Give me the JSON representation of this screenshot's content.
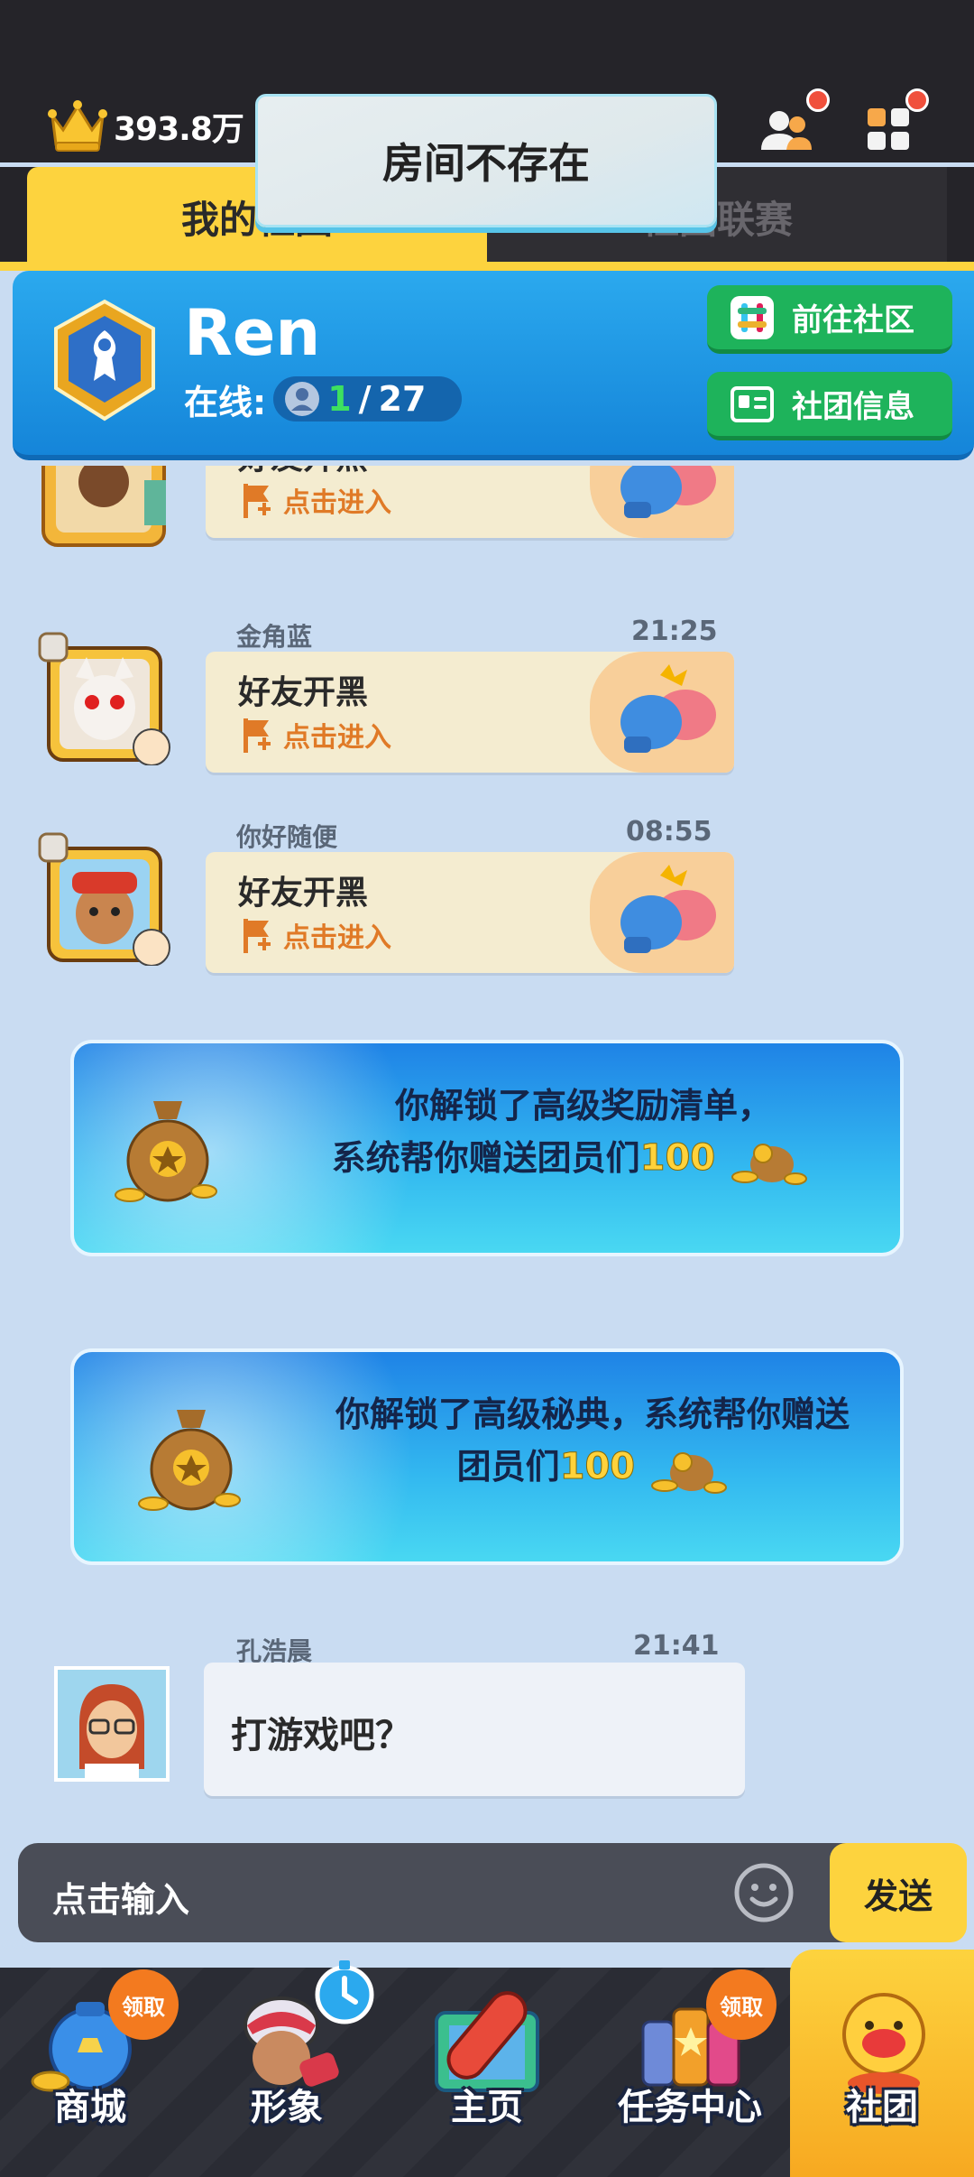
{
  "top_bar": {
    "currency_value": "393.8万",
    "currency_icon": "crown-icon",
    "friends_icon": "friends-icon",
    "apps_icon": "apps-icon"
  },
  "toast": {
    "message": "房间不存在"
  },
  "tabs": [
    {
      "label": "我的社团",
      "active": true
    },
    {
      "label": "社团联赛",
      "active": false
    }
  ],
  "club": {
    "name": "Ren",
    "online_label": "在线:",
    "online_count": "1",
    "online_sep": "/",
    "online_total": "27",
    "buttons": [
      {
        "label": "前往社区",
        "icon": "community-icon"
      },
      {
        "label": "社团信息",
        "icon": "id-card-icon"
      }
    ]
  },
  "messages": [
    {
      "type": "invite",
      "name": "",
      "time": "",
      "title": "好友开黑",
      "action": "点击进入"
    },
    {
      "type": "invite",
      "name": "金角蓝",
      "time": "21:25",
      "title": "好友开黑",
      "action": "点击进入"
    },
    {
      "type": "invite",
      "name": "你好随便",
      "time": "08:55",
      "title": "好友开黑",
      "action": "点击进入"
    }
  ],
  "system_cards": [
    {
      "line1": "你解锁了高级奖励清单，",
      "line2": "系统帮你赠送团员们",
      "amount": "100"
    },
    {
      "line1": "你解锁了高级秘典，系统帮你赠送",
      "line2": "团员们",
      "amount": "100"
    }
  ],
  "chat": {
    "name": "孔浩晨",
    "time": "21:41",
    "text": "打游戏吧？"
  },
  "input": {
    "placeholder": "点击输入",
    "send_label": "发送"
  },
  "bottom_nav": [
    {
      "label": "商城",
      "badge": "领取"
    },
    {
      "label": "形象",
      "badge": ""
    },
    {
      "label": "主页",
      "badge": ""
    },
    {
      "label": "任务中心",
      "badge": "领取"
    },
    {
      "label": "社团",
      "badge": "",
      "active": true
    }
  ],
  "colors": {
    "accent_yellow": "#fdd33e",
    "header_blue": "#1585d9",
    "green_button": "#1eb35b",
    "online_green": "#3de060"
  }
}
